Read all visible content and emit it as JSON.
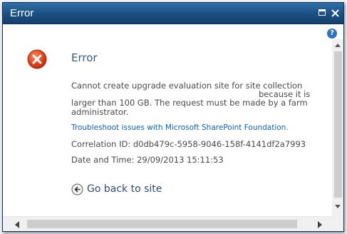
{
  "dialog": {
    "title": "Error",
    "heading": "Error",
    "message": {
      "line1": "Cannot create upgrade evaluation site for site collection",
      "line2": "because it is",
      "line3": "larger than 100 GB. The request must be made by a farm",
      "line4": "administrator."
    },
    "troubleshoot_link": "Troubleshoot issues with Microsoft SharePoint Foundation.",
    "correlation": "Correlation ID: d0db479c-5958-9046-158f-4141df2a7993",
    "datetime": "Date and Time: 29/09/2013 15:11:53",
    "back_label": "Go back to site",
    "help_glyph": "?"
  },
  "icons": {
    "error": "error-icon",
    "back": "back-arrow-icon",
    "maximize": "maximize-icon",
    "close": "close-icon",
    "help": "help-icon"
  },
  "colors": {
    "titlebar": "#1b4f82",
    "error_red": "#e0441c",
    "link": "#0f62b4"
  }
}
